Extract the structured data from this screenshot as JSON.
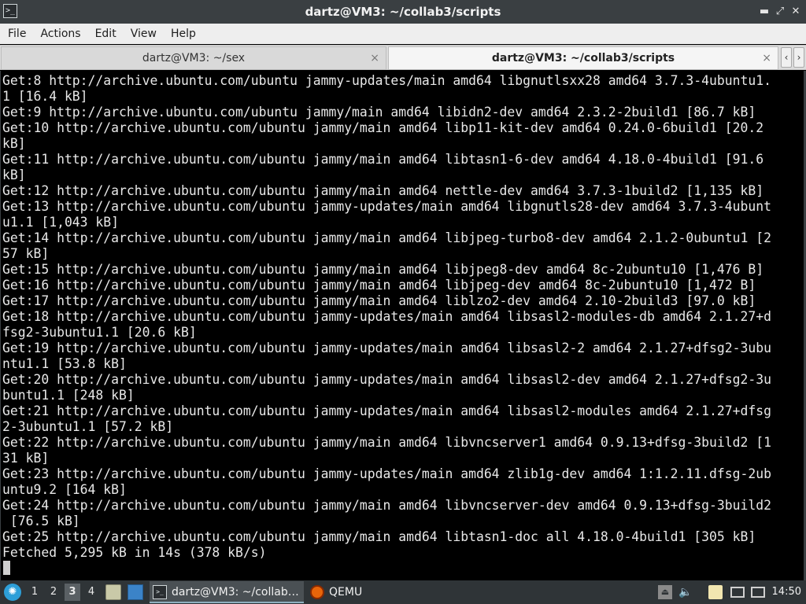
{
  "window": {
    "title": "dartz@VM3: ~/collab3/scripts",
    "app_icon": "terminal-icon",
    "app_icon_glyph": ">_",
    "controls": [
      "minimize-icon",
      "maximize-icon",
      "close-icon"
    ],
    "control_glyphs": {
      "minimize": "▬",
      "maximize": "⤢",
      "close": "✕"
    }
  },
  "menu": {
    "items": [
      "File",
      "Actions",
      "Edit",
      "View",
      "Help"
    ]
  },
  "tabs": [
    {
      "label": "dartz@VM3: ~/sex",
      "active": false,
      "close": "×"
    },
    {
      "label": "dartz@VM3: ~/collab3/scripts",
      "active": true,
      "close": "×"
    }
  ],
  "tab_scroll": {
    "left": "‹",
    "right": "›"
  },
  "terminal": {
    "lines": [
      "Get:8 http://archive.ubuntu.com/ubuntu jammy-updates/main amd64 libgnutlsxx28 amd64 3.7.3-4ubuntu1.",
      "1 [16.4 kB]",
      "Get:9 http://archive.ubuntu.com/ubuntu jammy/main amd64 libidn2-dev amd64 2.3.2-2build1 [86.7 kB]",
      "Get:10 http://archive.ubuntu.com/ubuntu jammy/main amd64 libp11-kit-dev amd64 0.24.0-6build1 [20.2",
      "kB]",
      "Get:11 http://archive.ubuntu.com/ubuntu jammy/main amd64 libtasn1-6-dev amd64 4.18.0-4build1 [91.6",
      "kB]",
      "Get:12 http://archive.ubuntu.com/ubuntu jammy/main amd64 nettle-dev amd64 3.7.3-1build2 [1,135 kB]",
      "Get:13 http://archive.ubuntu.com/ubuntu jammy-updates/main amd64 libgnutls28-dev amd64 3.7.3-4ubunt",
      "u1.1 [1,043 kB]",
      "Get:14 http://archive.ubuntu.com/ubuntu jammy/main amd64 libjpeg-turbo8-dev amd64 2.1.2-0ubuntu1 [2",
      "57 kB]",
      "Get:15 http://archive.ubuntu.com/ubuntu jammy/main amd64 libjpeg8-dev amd64 8c-2ubuntu10 [1,476 B]",
      "Get:16 http://archive.ubuntu.com/ubuntu jammy/main amd64 libjpeg-dev amd64 8c-2ubuntu10 [1,472 B]",
      "Get:17 http://archive.ubuntu.com/ubuntu jammy/main amd64 liblzo2-dev amd64 2.10-2build3 [97.0 kB]",
      "Get:18 http://archive.ubuntu.com/ubuntu jammy-updates/main amd64 libsasl2-modules-db amd64 2.1.27+d",
      "fsg2-3ubuntu1.1 [20.6 kB]",
      "Get:19 http://archive.ubuntu.com/ubuntu jammy-updates/main amd64 libsasl2-2 amd64 2.1.27+dfsg2-3ubu",
      "ntu1.1 [53.8 kB]",
      "Get:20 http://archive.ubuntu.com/ubuntu jammy-updates/main amd64 libsasl2-dev amd64 2.1.27+dfsg2-3u",
      "buntu1.1 [248 kB]",
      "Get:21 http://archive.ubuntu.com/ubuntu jammy-updates/main amd64 libsasl2-modules amd64 2.1.27+dfsg",
      "2-3ubuntu1.1 [57.2 kB]",
      "Get:22 http://archive.ubuntu.com/ubuntu jammy/main amd64 libvncserver1 amd64 0.9.13+dfsg-3build2 [1",
      "31 kB]",
      "Get:23 http://archive.ubuntu.com/ubuntu jammy-updates/main amd64 zlib1g-dev amd64 1:1.2.11.dfsg-2ub",
      "untu9.2 [164 kB]",
      "Get:24 http://archive.ubuntu.com/ubuntu jammy/main amd64 libvncserver-dev amd64 0.9.13+dfsg-3build2",
      " [76.5 kB]",
      "Get:25 http://archive.ubuntu.com/ubuntu jammy/main amd64 libtasn1-doc all 4.18.0-4build1 [305 kB]",
      "Fetched 5,295 kB in 14s (378 kB/s)"
    ]
  },
  "taskbar": {
    "start_icon": "start-menu-icon",
    "start_glyph": "✺",
    "workspaces": [
      "1",
      "2",
      "3",
      "4"
    ],
    "current_workspace": "3",
    "launchers": [
      "file-manager-icon",
      "show-desktop-icon"
    ],
    "tasks": [
      {
        "label": "dartz@VM3: ~/collab…",
        "icon": "terminal-icon",
        "active": true
      },
      {
        "label": "QEMU",
        "icon": "qemu-icon",
        "active": false
      }
    ],
    "tray": [
      {
        "icon": "eject-icon",
        "glyph": "⏏"
      },
      {
        "icon": "volume-icon",
        "glyph": "🔈"
      },
      {
        "icon": "clipboard-icon",
        "glyph": "▭"
      },
      {
        "icon": "network-icon",
        "glyph": "▭"
      },
      {
        "icon": "display-icon",
        "glyph": "▭"
      }
    ],
    "clock": "14:50"
  },
  "colors": {
    "titlebar": "#3a3f42",
    "terminal_bg": "#000000",
    "terminal_fg": "#e8e8e8",
    "taskbar": "#2f3437",
    "accent": "#2d9fd8"
  }
}
